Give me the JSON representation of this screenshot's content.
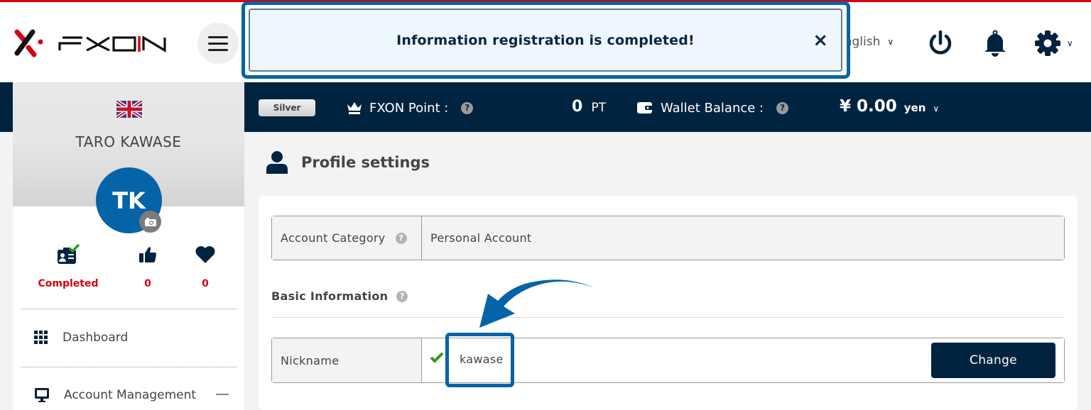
{
  "header": {
    "brand": "FXON",
    "language": "English",
    "icons": [
      "menu-icon",
      "power-icon",
      "bell-icon",
      "gear-icon"
    ]
  },
  "notification": {
    "message": "Information registration is completed!",
    "close_label": "×"
  },
  "statbar": {
    "rank": "Silver",
    "points_label": "FXON Point :",
    "points_value": "0",
    "points_unit": "PT",
    "wallet_label": "Wallet Balance :",
    "wallet_value": "¥ 0.00",
    "wallet_unit": "yen",
    "help": "?"
  },
  "sidebar": {
    "user_name": "TARO KAWASE",
    "initials": "TK",
    "stats": [
      {
        "icon": "id-card-check-icon",
        "value": "Completed"
      },
      {
        "icon": "thumbs-up-icon",
        "value": "0"
      },
      {
        "icon": "heart-icon",
        "value": "0"
      }
    ],
    "nav": [
      {
        "icon": "grid-icon",
        "label": "Dashboard"
      },
      {
        "icon": "monitor-icon",
        "label": "Account Management"
      }
    ]
  },
  "main": {
    "page_title": "Profile settings",
    "account_category": {
      "label": "Account Category",
      "value": "Personal Account"
    },
    "section_title": "Basic Information",
    "nickname": {
      "label": "Nickname",
      "value": "kawase",
      "button": "Change"
    }
  },
  "colors": {
    "accent_red": "#d7000f",
    "navy": "#00233f",
    "highlight_blue": "#0563a7",
    "success_green": "#2a9d1a"
  }
}
